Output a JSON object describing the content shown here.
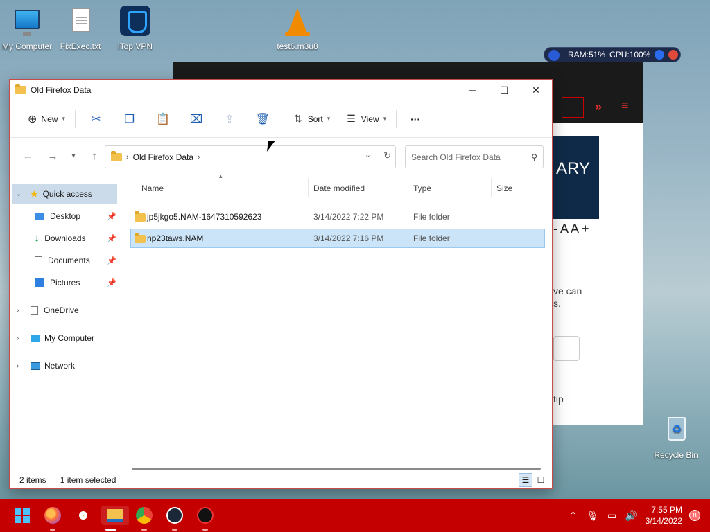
{
  "desktop": {
    "icons": [
      {
        "label": "My Computer"
      },
      {
        "label": "FixExec.txt"
      },
      {
        "label": "iTop VPN"
      },
      {
        "label": "test6.m3u8"
      },
      {
        "label": "Recycle Bin"
      }
    ]
  },
  "system_widget": {
    "ram": "RAM:51%",
    "cpu": "CPU:100%"
  },
  "background_window": {
    "banner_text": "ARY",
    "font_size_control": "- A A +",
    "text_line1": "ve can",
    "text_line2": "s.",
    "text_line3": "tip"
  },
  "explorer": {
    "title": "Old Firefox Data",
    "toolbar": {
      "new_label": "New",
      "sort_label": "Sort",
      "view_label": "View",
      "more_label": "···"
    },
    "address": {
      "crumb": "Old Firefox Data"
    },
    "search": {
      "placeholder": "Search Old Firefox Data"
    },
    "nav": {
      "quick_access": "Quick access",
      "desktop": "Desktop",
      "downloads": "Downloads",
      "documents": "Documents",
      "pictures": "Pictures",
      "onedrive": "OneDrive",
      "my_computer": "My Computer",
      "network": "Network"
    },
    "columns": {
      "name": "Name",
      "date": "Date modified",
      "type": "Type",
      "size": "Size"
    },
    "files": [
      {
        "name": "jp5jkgo5.NAM-1647310592623",
        "date": "3/14/2022 7:22 PM",
        "type": "File folder",
        "size": ""
      },
      {
        "name": "np23taws.NAM",
        "date": "3/14/2022 7:16 PM",
        "type": "File folder",
        "size": ""
      }
    ],
    "status": {
      "items": "2 items",
      "selected": "1 item selected"
    }
  },
  "taskbar": {
    "clock_time": "7:55 PM",
    "clock_date": "3/14/2022",
    "notifications": "8"
  },
  "colors": {
    "taskbar": "#c40000",
    "selection": "#cce4f7",
    "accent": "#1d5fb3"
  }
}
